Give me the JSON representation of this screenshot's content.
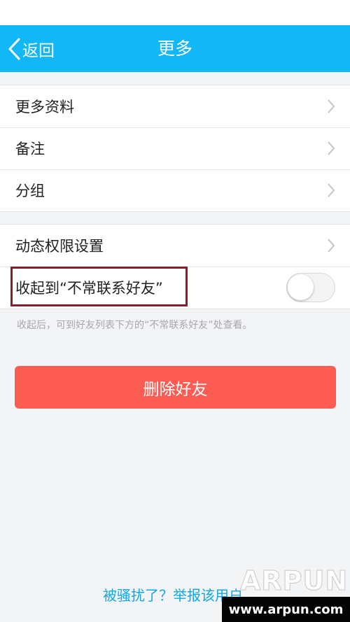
{
  "nav": {
    "back_label": "返回",
    "title": "更多",
    "background_color": "#12b7f5"
  },
  "group1": {
    "items": [
      {
        "label": "更多资料"
      },
      {
        "label": "备注"
      },
      {
        "label": "分组"
      }
    ]
  },
  "group2": {
    "permissions_label": "动态权限设置",
    "hide_label": "收起到“不常联系好友”",
    "hide_toggle_on": false
  },
  "hint": "收起后，可到好友列表下方的“不常联系好友”处查看。",
  "delete_button": {
    "label": "删除好友",
    "color": "#fd5c52"
  },
  "report_link": "被骚扰了？举报该用户",
  "watermark": {
    "logo": "ARPUN",
    "url": "www.arpun.com"
  },
  "icons": [
    "back-chevron-icon",
    "chevron-right-icon"
  ]
}
